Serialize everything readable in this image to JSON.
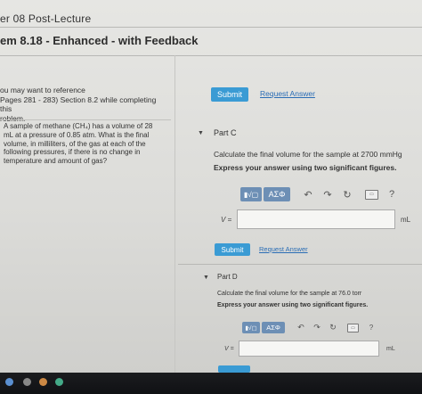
{
  "header": {
    "chapter": "er 08 Post-Lecture",
    "title": "em 8.18 - Enhanced - with Feedback"
  },
  "left": {
    "reference_lines": [
      "ou may want to reference",
      "Pages 281 - 283) Section 8.2 while completing this",
      "roblem."
    ],
    "problem_lines": [
      "A sample of methane (CH₄) has a volume of 28",
      "mL at a pressure of 0.85 atm. What is the final",
      "volume, in milliliters, of the gas at each of the",
      "following pressures, if there is no change in",
      "temperature and amount of gas?"
    ]
  },
  "top_actions": {
    "submit": "Submit",
    "request": "Request Answer"
  },
  "part_c": {
    "label": "Part C",
    "prompt": "Calculate the final volume for the sample at 2700 mmHg",
    "instruction": "Express your answer using two significant figures.",
    "greek_label": "ΑΣΦ",
    "help_label": "?",
    "var_label": "V =",
    "unit": "mL",
    "answer_value": "",
    "submit": "Submit",
    "request": "Request Answer"
  },
  "part_d": {
    "label": "Part D",
    "prompt": "Calculate the final volume for the sample at 76.0 torr",
    "instruction": "Express your answer using two significant figures.",
    "greek_label": "ΑΣΦ",
    "help_label": "?",
    "var_label": "V =",
    "unit": "mL",
    "answer_value": ""
  },
  "icons": {
    "templates": "templates-icon",
    "undo": "undo-icon",
    "redo": "redo-icon",
    "reset": "reset-icon",
    "keyboard": "keyboard-icon",
    "help": "help-icon",
    "caret": "caret-down-icon"
  },
  "colors": {
    "submit": "#3a9bd4",
    "link": "#2a6db5",
    "toolbar": "#6d8fb5"
  }
}
